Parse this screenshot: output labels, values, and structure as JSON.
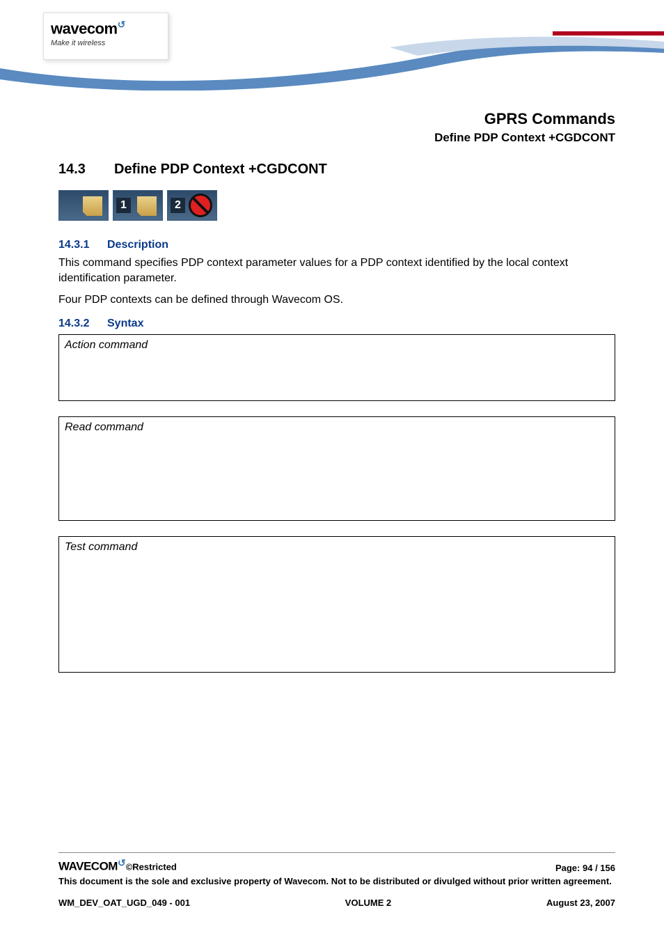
{
  "logo": {
    "brand": "wavecom",
    "tagline": "Make it wireless"
  },
  "chapter": {
    "title": "GPRS Commands",
    "subtitle": "Define PDP Context +CGDCONT"
  },
  "section": {
    "number": "14.3",
    "title": "Define PDP Context +CGDCONT"
  },
  "badges": {
    "b1_num": "",
    "b2_num": "1",
    "b3_num": "2"
  },
  "sub1": {
    "number": "14.3.1",
    "title": "Description",
    "p1": "This command specifies PDP context parameter values for a PDP context identified by the local context identification parameter.",
    "p2": "Four PDP contexts can be defined through Wavecom OS."
  },
  "sub2": {
    "number": "14.3.2",
    "title": "Syntax",
    "box1": "Action command",
    "box2": "Read command",
    "box3": "Test command"
  },
  "footer": {
    "restricted": "©Restricted",
    "page_label": "Page: ",
    "page_cur": "94",
    "page_sep": " / ",
    "page_total": "156",
    "disclaimer": "This document is the sole and exclusive property of Wavecom. Not to be distributed or divulged without prior written agreement.",
    "doc_id": "WM_DEV_OAT_UGD_049 - 001",
    "volume": "VOLUME 2",
    "date": "August 23, 2007",
    "brand": "WAVECOM"
  }
}
